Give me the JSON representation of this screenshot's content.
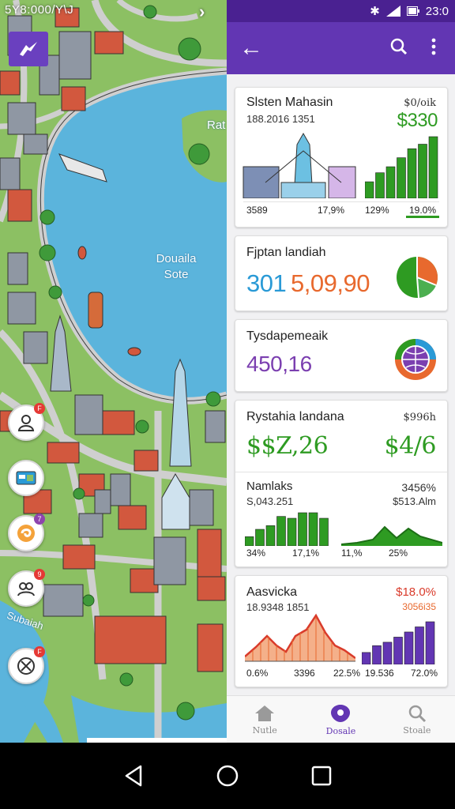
{
  "map": {
    "status_left": "5Y8:000/Y\\J",
    "chevron": "›",
    "labels": [
      "Douaila Sote",
      "Rat",
      "Subaiah"
    ],
    "fab_badges": [
      "F",
      "",
      "7",
      "9",
      "F"
    ]
  },
  "statusbar": {
    "time": "23:0"
  },
  "cards": {
    "c1": {
      "title": "Slsten Mahasin",
      "sub": "188.2016 1351",
      "right_small": "$0/oik",
      "right_big": "$330",
      "foot": [
        "3589",
        "17,9%",
        "129%",
        "19.0%"
      ],
      "bars": [
        22,
        34,
        42,
        54,
        66,
        72,
        82
      ]
    },
    "c2": {
      "title": "Fjptan landiah",
      "value_a": "301",
      "value_b": "5,09,90"
    },
    "c3": {
      "title": "Tysdapemeaik",
      "value": "450,16"
    },
    "c4": {
      "title": "Rystahia landana",
      "right_small": "$996h",
      "left_big": "$$Z,26",
      "right_big": "$4/6"
    },
    "c5": {
      "title": "Namlaks",
      "sub": "S,043.251",
      "right_a": "3456%",
      "right_b": "$513.Alm",
      "foot": [
        "34%",
        "17,1%",
        "11,%",
        "25%"
      ],
      "bars": [
        10,
        18,
        22,
        32,
        30,
        36,
        36,
        30
      ]
    },
    "c6": {
      "title": "Aasvicka",
      "sub": "18.9348 1851",
      "right_a": "$18.0%",
      "right_b": "3056i35",
      "foot": [
        "0.6%",
        "3396",
        "22.5%",
        "19.536",
        "72.0%"
      ],
      "bars": [
        14,
        22,
        26,
        32,
        38,
        44,
        50
      ]
    }
  },
  "bottomnav": [
    {
      "label": "Nutle",
      "icon": "home-icon"
    },
    {
      "label": "Dosale",
      "icon": "shield-icon"
    },
    {
      "label": "Stoale",
      "icon": "search-icon"
    }
  ],
  "colors": {
    "purple": "#6236b3",
    "purple_dark": "#4a2191",
    "green": "#2e9b22",
    "orange": "#e8692e",
    "water": "#5bb4dc"
  }
}
